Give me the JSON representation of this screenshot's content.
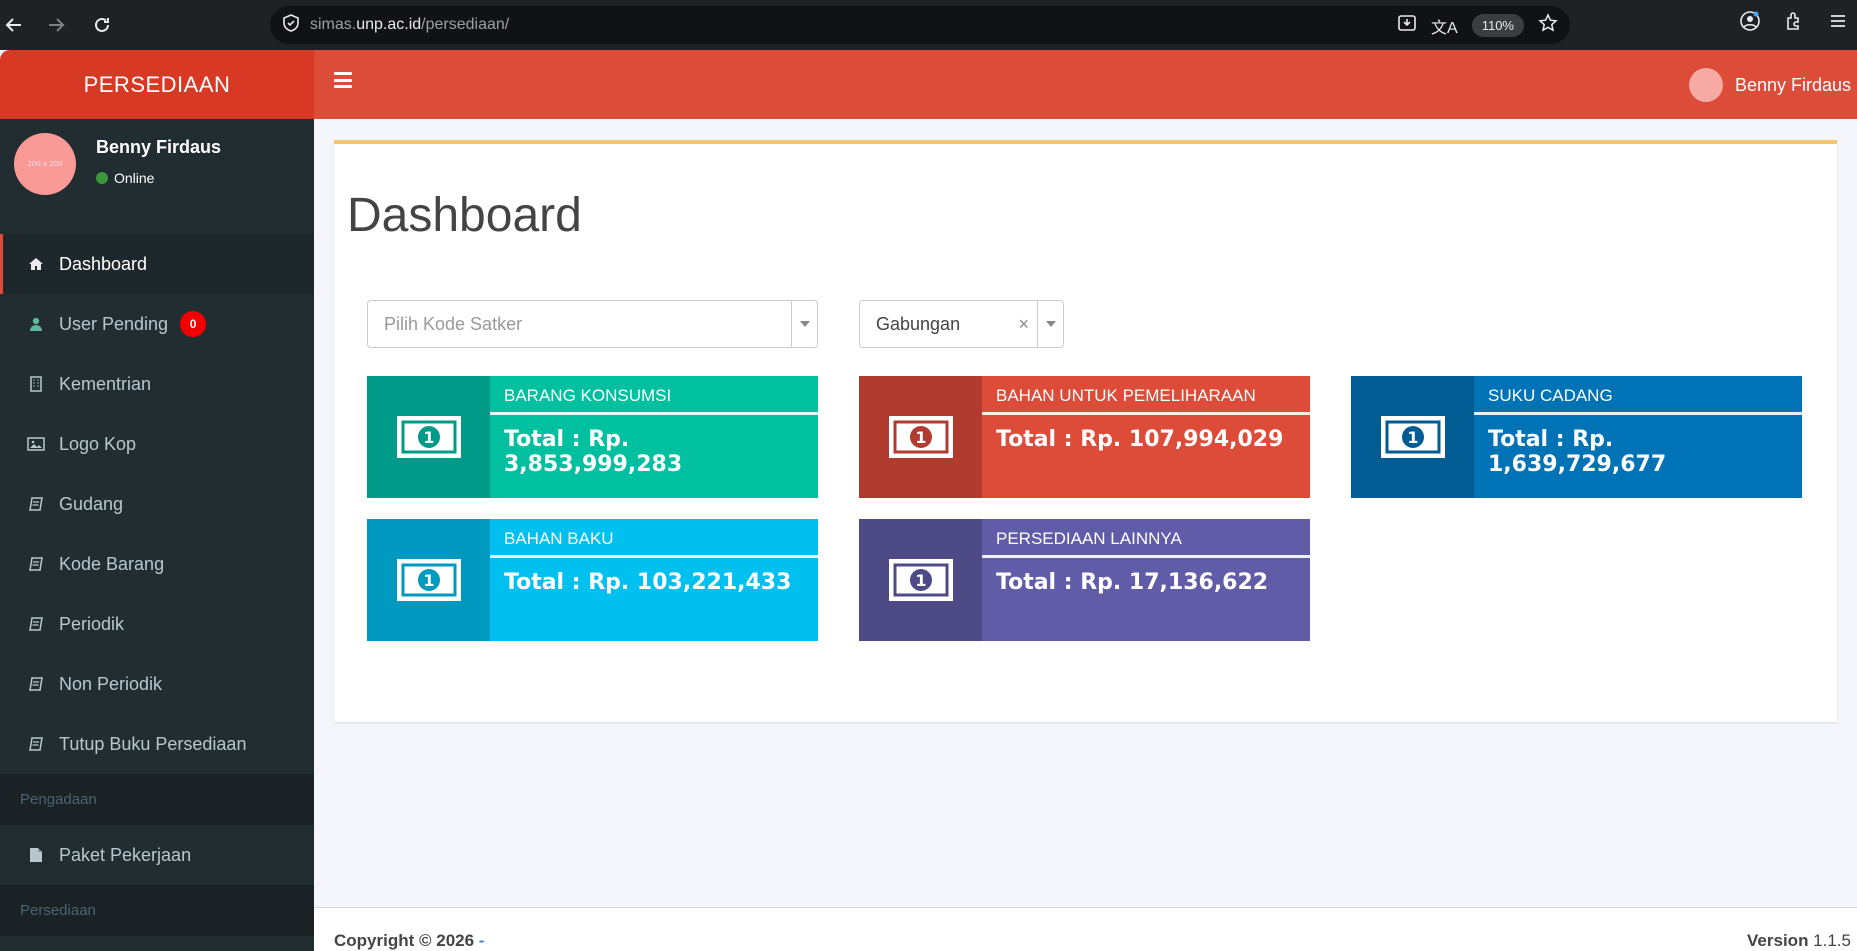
{
  "browser": {
    "url_prefix": "simas.",
    "url_domain": "unp.ac.id",
    "url_path": "/persediaan/",
    "zoom": "110%"
  },
  "header": {
    "logo": "PERSEDIAAN",
    "user_name": "Benny Firdaus"
  },
  "sidebar": {
    "user_name": "Benny Firdaus",
    "status": "Online",
    "avatar_text": "200 x 200",
    "items": [
      {
        "label": "Dashboard",
        "icon": "home-icon",
        "active": true
      },
      {
        "label": "User Pending",
        "icon": "user-icon",
        "badge": "0"
      },
      {
        "label": "Kementrian",
        "icon": "building-icon"
      },
      {
        "label": "Logo Kop",
        "icon": "image-icon"
      },
      {
        "label": "Gudang",
        "icon": "book-icon"
      },
      {
        "label": "Kode Barang",
        "icon": "book-icon"
      },
      {
        "label": "Periodik",
        "icon": "book-icon"
      },
      {
        "label": "Non Periodik",
        "icon": "book-icon"
      },
      {
        "label": "Tutup Buku Persediaan",
        "icon": "book-icon"
      }
    ],
    "section_pengadaan": "Pengadaan",
    "paket_pekerjaan": "Paket Pekerjaan",
    "section_persediaan": "Persediaan"
  },
  "main": {
    "title": "Dashboard",
    "satker_placeholder": "Pilih Kode Satker",
    "filter_value": "Gabungan",
    "cards": [
      {
        "label": "BARANG KONSUMSI",
        "value": "Total : Rp. 3,853,999,283",
        "color": "#00c0a0",
        "icon_bg": "#009b88"
      },
      {
        "label": "BAHAN UNTUK PEMELIHARAAN",
        "value": "Total : Rp. 107,994,029",
        "color": "#dd4b39",
        "icon_bg": "#b13b2e"
      },
      {
        "label": "SUKU CADANG",
        "value": "Total : Rp. 1,639,729,677",
        "color": "#0073b7",
        "icon_bg": "#005c92"
      },
      {
        "label": "BAHAN BAKU",
        "value": "Total : Rp. 103,221,433",
        "color": "#00c0ef",
        "icon_bg": "#009ac0"
      },
      {
        "label": "PERSEDIAAN LAINNYA",
        "value": "Total : Rp. 17,136,622",
        "color": "#605ca8",
        "icon_bg": "#4d4a86"
      }
    ]
  },
  "footer": {
    "copyright": "Copyright © 2026 ",
    "link": "-",
    "version_label": "Version",
    "version": " 1.1.5"
  }
}
